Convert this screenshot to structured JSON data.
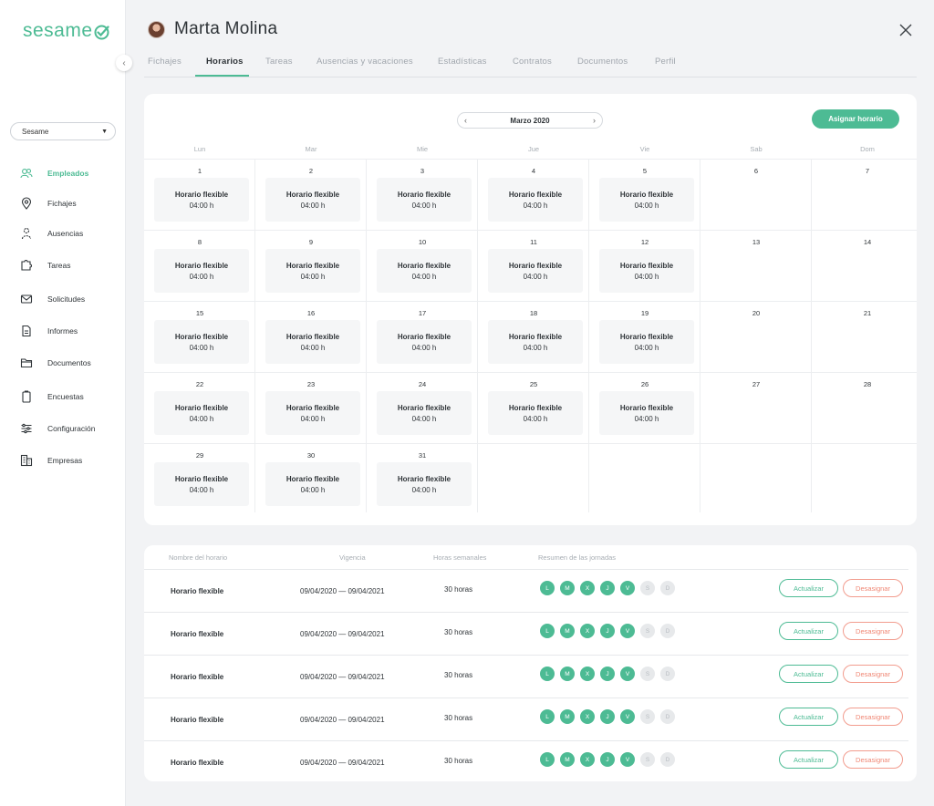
{
  "brand": {
    "name": "sesame",
    "accent": "#4dbb94"
  },
  "sidebar": {
    "company_select": "Sesame",
    "items": [
      {
        "label": "Empleados",
        "icon": "people-icon",
        "active": true
      },
      {
        "label": "Fichajes",
        "icon": "location-pin-icon",
        "active": false
      },
      {
        "label": "Ausencias",
        "icon": "person-away-icon",
        "active": false
      },
      {
        "label": "Tareas",
        "icon": "puzzle-icon",
        "active": false
      },
      {
        "label": "Solicitudes",
        "icon": "envelope-icon",
        "active": false
      },
      {
        "label": "Informes",
        "icon": "document-icon",
        "active": false
      },
      {
        "label": "Documentos",
        "icon": "folder-icon",
        "active": false
      },
      {
        "label": "Encuestas",
        "icon": "clipboard-icon",
        "active": false
      },
      {
        "label": "Configuración",
        "icon": "sliders-icon",
        "active": false
      },
      {
        "label": "Empresas",
        "icon": "building-icon",
        "active": false
      }
    ]
  },
  "header": {
    "employee_name": "Marta Molina"
  },
  "tabs": [
    {
      "label": "Fichajes",
      "active": false
    },
    {
      "label": "Horarios",
      "active": true
    },
    {
      "label": "Tareas",
      "active": false
    },
    {
      "label": "Ausencias y vacaciones",
      "active": false
    },
    {
      "label": "Estadísticas",
      "active": false
    },
    {
      "label": "Contratos",
      "active": false
    },
    {
      "label": "Documentos",
      "active": false
    },
    {
      "label": "Perfil",
      "active": false
    }
  ],
  "calendar": {
    "month_label": "Marzo 2020",
    "assign_button": "Asignar horario",
    "weekdays": [
      "Lun",
      "Mar",
      "Mie",
      "Jue",
      "Vie",
      "Sab",
      "Dom"
    ],
    "shift_name": "Horario flexible",
    "shift_hours": "04:00 h",
    "weeks": [
      [
        {
          "d": "1",
          "s": true
        },
        {
          "d": "2",
          "s": true
        },
        {
          "d": "3",
          "s": true
        },
        {
          "d": "4",
          "s": true
        },
        {
          "d": "5",
          "s": true
        },
        {
          "d": "6",
          "s": false
        },
        {
          "d": "7",
          "s": false
        }
      ],
      [
        {
          "d": "8",
          "s": true
        },
        {
          "d": "9",
          "s": true
        },
        {
          "d": "10",
          "s": true
        },
        {
          "d": "11",
          "s": true
        },
        {
          "d": "12",
          "s": true
        },
        {
          "d": "13",
          "s": false
        },
        {
          "d": "14",
          "s": false
        }
      ],
      [
        {
          "d": "15",
          "s": true
        },
        {
          "d": "16",
          "s": true
        },
        {
          "d": "17",
          "s": true
        },
        {
          "d": "18",
          "s": true
        },
        {
          "d": "19",
          "s": true
        },
        {
          "d": "20",
          "s": false
        },
        {
          "d": "21",
          "s": false
        }
      ],
      [
        {
          "d": "22",
          "s": true
        },
        {
          "d": "23",
          "s": true
        },
        {
          "d": "24",
          "s": true
        },
        {
          "d": "25",
          "s": true
        },
        {
          "d": "26",
          "s": true
        },
        {
          "d": "27",
          "s": false
        },
        {
          "d": "28",
          "s": false
        }
      ],
      [
        {
          "d": "29",
          "s": true
        },
        {
          "d": "30",
          "s": true
        },
        {
          "d": "31",
          "s": true
        },
        {
          "d": "",
          "s": false
        },
        {
          "d": "",
          "s": false
        },
        {
          "d": "",
          "s": false
        },
        {
          "d": "",
          "s": false
        }
      ]
    ]
  },
  "schedules": {
    "headers": [
      "Nombre del horario",
      "Vigencia",
      "Horas semanales",
      "Resumen de las jornadas"
    ],
    "update_label": "Actualizar",
    "unassign_label": "Desasignar",
    "day_letters": [
      "L",
      "M",
      "X",
      "J",
      "V",
      "S",
      "D"
    ],
    "rows": [
      {
        "name": "Horario flexible",
        "validity": "09/04/2020 — 09/04/2021",
        "hours": "30 horas",
        "days_on": [
          true,
          true,
          true,
          true,
          true,
          false,
          false
        ]
      },
      {
        "name": "Horario flexible",
        "validity": "09/04/2020 — 09/04/2021",
        "hours": "30 horas",
        "days_on": [
          true,
          true,
          true,
          true,
          true,
          false,
          false
        ]
      },
      {
        "name": "Horario flexible",
        "validity": "09/04/2020 — 09/04/2021",
        "hours": "30 horas",
        "days_on": [
          true,
          true,
          true,
          true,
          true,
          false,
          false
        ]
      },
      {
        "name": "Horario flexible",
        "validity": "09/04/2020 — 09/04/2021",
        "hours": "30 horas",
        "days_on": [
          true,
          true,
          true,
          true,
          true,
          false,
          false
        ]
      },
      {
        "name": "Horario flexible",
        "validity": "09/04/2020 — 09/04/2021",
        "hours": "30 horas",
        "days_on": [
          true,
          true,
          true,
          true,
          true,
          false,
          false
        ]
      }
    ]
  }
}
